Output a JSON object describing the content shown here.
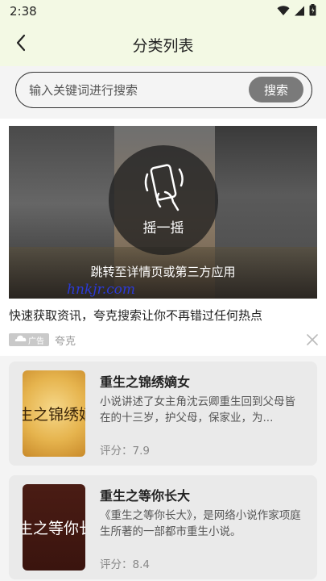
{
  "status_bar": {
    "time": "2:38",
    "icons": [
      "wifi-icon",
      "signal-icon",
      "battery-icon"
    ]
  },
  "header": {
    "back_icon": "chevron-left-icon",
    "title": "分类列表"
  },
  "search": {
    "placeholder": "输入关键词进行搜索",
    "button_label": "搜索"
  },
  "ad": {
    "shake_label": "摇一摇",
    "jump_text": "跳转至详情页或第三方应用",
    "watermark": "hnkjr.com",
    "headline": "快速获取资讯，夸克搜索让你不再错过任何热点",
    "badge": "广告",
    "source": "夸克",
    "close_icon": "close-icon"
  },
  "books": [
    {
      "title": "重生之锦绣嫡女",
      "cover_text": "生之锦绣嫡",
      "description": "小说讲述了女主角沈云卿重生回到父母皆在的十三岁，护父母，保家业，为...",
      "rating": "评分：7.9"
    },
    {
      "title": "重生之等你长大",
      "cover_text": "生之等你长",
      "description": "《重生之等你长大》，是网络小说作家项庭生所著的一部都市重生小说。",
      "rating": "评分：8.4"
    }
  ],
  "colors": {
    "header_bg": "#f3f9e4",
    "search_button": "#7a7a7a",
    "card_bg": "#eaeaea",
    "watermark": "#2b3ad8"
  }
}
